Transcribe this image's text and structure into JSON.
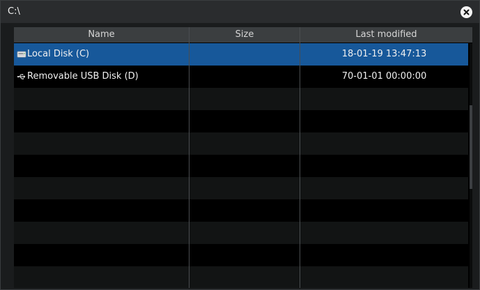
{
  "window": {
    "title": "C:\\"
  },
  "table": {
    "columns": [
      "Name",
      "Size",
      "Last modified"
    ],
    "rows": [
      {
        "name": "Local Disk (C)",
        "size": "",
        "modified": "18-01-19 13:47:13",
        "icon": "hard-drive-icon",
        "selected": true
      },
      {
        "name": "Removable USB Disk (D)",
        "size": "",
        "modified": "70-01-01 00:00:00",
        "icon": "usb-icon",
        "selected": false
      }
    ]
  },
  "colors": {
    "selection": "#17589a",
    "header": "#3b3e40",
    "titlebar": "#2a2c2e"
  }
}
